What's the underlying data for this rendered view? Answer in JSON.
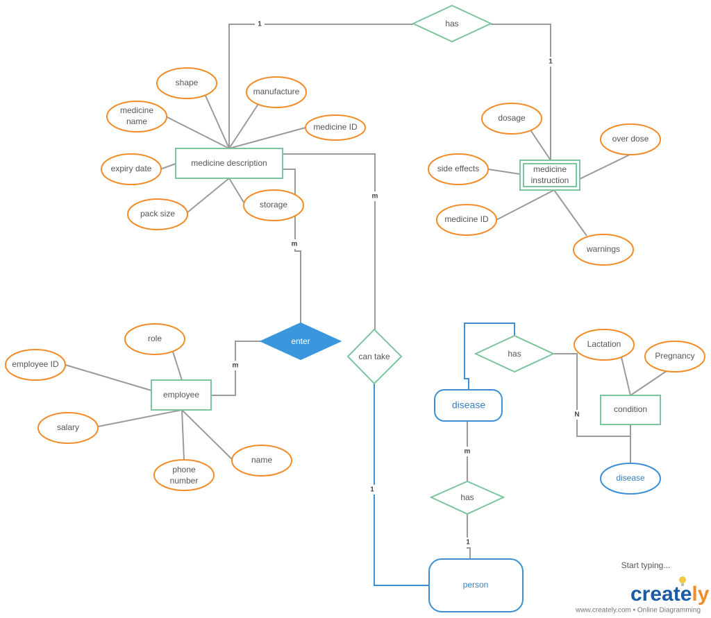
{
  "entities": {
    "medicine_description": "medicine description",
    "medicine_instruction_1": "medicine",
    "medicine_instruction_2": "instruction",
    "employee": "employee",
    "condition": "condition",
    "disease": "disease",
    "person": "person"
  },
  "relationships": {
    "has_top": "has",
    "enter": "enter",
    "can_take": "can take",
    "has_disease_condition": "has",
    "has_person_disease": "has"
  },
  "attributes": {
    "shape": "shape",
    "manufacture": "manufacture",
    "medicine_name_1": "medicine",
    "medicine_name_2": "name",
    "medicine_id": "medicine ID",
    "expiry_date": "expiry date",
    "pack_size": "pack size",
    "storage": "storage",
    "dosage": "dosage",
    "over_dose": "over dose",
    "side_effects": "side effects",
    "instruction_medicine_id": "medicine ID",
    "warnings": "warnings",
    "role": "role",
    "employee_id": "employee ID",
    "salary": "salary",
    "phone_number_1": "phone",
    "phone_number_2": "number",
    "name": "name",
    "lactation": "Lactation",
    "pregnancy": "Pregnancy",
    "condition_disease": "disease"
  },
  "cardinalities": {
    "top_left": "1",
    "top_right": "1",
    "desc_cantake": "m",
    "desc_enter": "m",
    "employee_enter": "m",
    "cantake_person": "1",
    "has_condition": "N",
    "disease_has": "m",
    "has_person": "1"
  },
  "footer": {
    "start_typing": "Start typing...",
    "brand_main": "creat",
    "brand_tail": "ly",
    "brand_e": "e",
    "tagline": "www.creately.com • Online Diagramming"
  },
  "colors": {
    "entity": "#7cc49d",
    "attribute": "#f28c28",
    "blue": "#3a8fd6",
    "enter_fill": "#3a96dd"
  }
}
